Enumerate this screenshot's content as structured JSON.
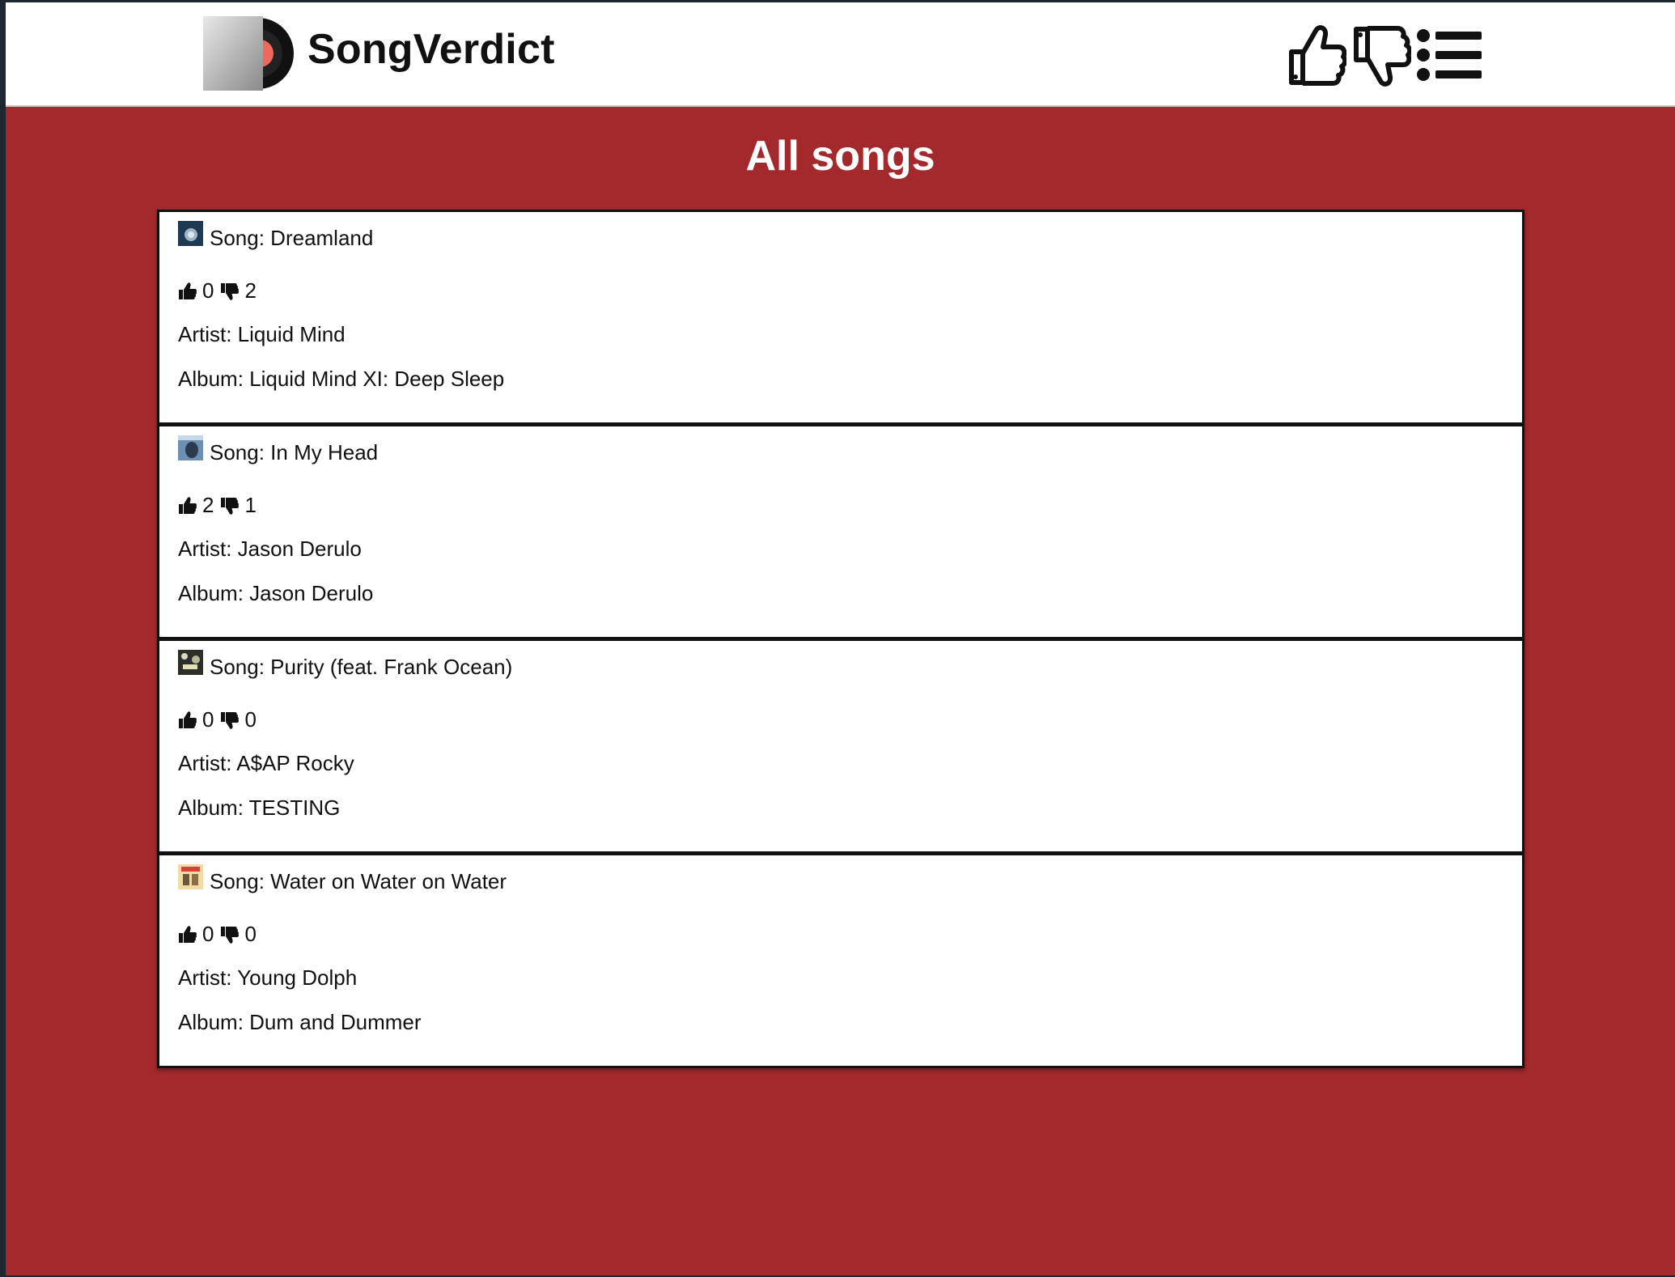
{
  "app": {
    "brand": "SongVerdict",
    "accent_color": "#a3292d"
  },
  "header": {
    "logo_icon": "record-sleeve-logo",
    "nav_icons": [
      "thumbs-up-icon",
      "thumbs-down-icon",
      "list-icon"
    ]
  },
  "main": {
    "title": "All songs"
  },
  "songs": [
    {
      "song": "Song: Dreamland",
      "likes": "0",
      "dislikes": "2",
      "artist": "Artist: Liquid Mind",
      "album": "Album: Liquid Mind XI: Deep Sleep",
      "thumb_color": "#2a4b66"
    },
    {
      "song": "Song: In My Head",
      "likes": "2",
      "dislikes": "1",
      "artist": "Artist: Jason Derulo",
      "album": "Album: Jason Derulo",
      "thumb_color": "#5d7da0"
    },
    {
      "song": "Song: Purity (feat. Frank Ocean)",
      "likes": "0",
      "dislikes": "0",
      "artist": "Artist: A$AP Rocky",
      "album": "Album: TESTING",
      "thumb_color": "#3a3f33"
    },
    {
      "song": "Song: Water on Water on Water",
      "likes": "0",
      "dislikes": "0",
      "artist": "Artist: Young Dolph",
      "album": "Album: Dum and Dummer",
      "thumb_color": "#e8c98a"
    }
  ]
}
